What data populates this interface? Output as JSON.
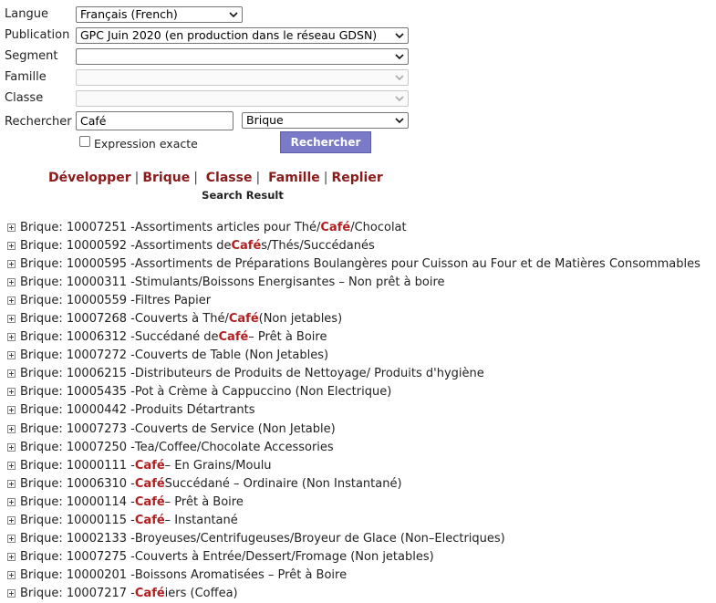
{
  "form": {
    "langue_label": "Langue",
    "langue_value": "Français (French)",
    "publication_label": "Publication",
    "publication_value": "GPC Juin 2020 (en production dans le réseau GDSN)",
    "segment_label": "Segment",
    "segment_value": "",
    "famille_label": "Famille",
    "famille_value": "",
    "classe_label": "Classe",
    "classe_value": "",
    "rechercher_label": "Rechercher",
    "search_value": "Café",
    "level_value": "Brique",
    "exact_label": "Expression exacte",
    "exact_checked": false,
    "submit_label": "Rechercher"
  },
  "links": {
    "developper": "Développer",
    "brique": "Brique",
    "classe": "Classe",
    "famille": "Famille",
    "replier": "Replier",
    "sep": "|"
  },
  "result_title": "Search Result",
  "highlight_color": "#b02020",
  "results": [
    {
      "prefix": "Brique: 10007251 - ",
      "parts": [
        {
          "t": "Assortiments articles pour Thé/"
        },
        {
          "t": "Café",
          "h": true
        },
        {
          "t": "/Chocolat"
        }
      ]
    },
    {
      "prefix": "Brique: 10000592 - ",
      "parts": [
        {
          "t": "Assortiments de "
        },
        {
          "t": "Café",
          "h": true
        },
        {
          "t": "s/Thés/Succédanés"
        }
      ]
    },
    {
      "prefix": "Brique: 10000595 - ",
      "parts": [
        {
          "t": "Assortiments de Préparations Boulangères pour Cuisson au Four et de Matières Consommables"
        }
      ]
    },
    {
      "prefix": "Brique: 10000311 - ",
      "parts": [
        {
          "t": "Stimulants/Boissons Energisantes – Non prêt à boire"
        }
      ]
    },
    {
      "prefix": "Brique: 10000559 - ",
      "parts": [
        {
          "t": "Filtres Papier"
        }
      ]
    },
    {
      "prefix": "Brique: 10007268 - ",
      "parts": [
        {
          "t": "Couverts à Thé/"
        },
        {
          "t": "Café",
          "h": true
        },
        {
          "t": " (Non jetables)"
        }
      ]
    },
    {
      "prefix": "Brique: 10006312 - ",
      "parts": [
        {
          "t": "Succédané de "
        },
        {
          "t": "Café",
          "h": true
        },
        {
          "t": " – Prêt à Boire"
        }
      ]
    },
    {
      "prefix": "Brique: 10007272 - ",
      "parts": [
        {
          "t": "Couverts de Table (Non Jetables)"
        }
      ]
    },
    {
      "prefix": "Brique: 10006215 - ",
      "parts": [
        {
          "t": "Distributeurs de Produits de Nettoyage/ Produits d'hygiène"
        }
      ]
    },
    {
      "prefix": "Brique: 10005435 - ",
      "parts": [
        {
          "t": "Pot à Crème à Cappuccino (Non Electrique)"
        }
      ]
    },
    {
      "prefix": "Brique: 10000442 - ",
      "parts": [
        {
          "t": "Produits Détartrants"
        }
      ]
    },
    {
      "prefix": "Brique: 10007273 - ",
      "parts": [
        {
          "t": "Couverts de Service (Non Jetable)"
        }
      ]
    },
    {
      "prefix": "Brique: 10007250 - ",
      "parts": [
        {
          "t": "Tea/Coffee/Chocolate Accessories"
        }
      ]
    },
    {
      "prefix": "Brique: 10000111 - ",
      "parts": [
        {
          "t": "Café",
          "h": true
        },
        {
          "t": " – En Grains/Moulu"
        }
      ]
    },
    {
      "prefix": "Brique: 10006310 - ",
      "parts": [
        {
          "t": "Café",
          "h": true
        },
        {
          "t": " Succédané – Ordinaire (Non Instantané)"
        }
      ]
    },
    {
      "prefix": "Brique: 10000114 - ",
      "parts": [
        {
          "t": "Café",
          "h": true
        },
        {
          "t": " – Prêt à Boire"
        }
      ]
    },
    {
      "prefix": "Brique: 10000115 - ",
      "parts": [
        {
          "t": "Café",
          "h": true
        },
        {
          "t": " – Instantané"
        }
      ]
    },
    {
      "prefix": "Brique: 10002133 - ",
      "parts": [
        {
          "t": "Broyeuses/Centrifugeuses/Broyeur de Glace (Non–Electriques)"
        }
      ]
    },
    {
      "prefix": "Brique: 10007275 - ",
      "parts": [
        {
          "t": "Couverts à Entrée/Dessert/Fromage (Non jetables)"
        }
      ]
    },
    {
      "prefix": "Brique: 10000201 - ",
      "parts": [
        {
          "t": "Boissons Aromatisées – Prêt à Boire"
        }
      ]
    },
    {
      "prefix": "Brique: 10007217 - ",
      "parts": [
        {
          "t": "Café",
          "h": true
        },
        {
          "t": "iers (Coffea)"
        }
      ]
    }
  ]
}
